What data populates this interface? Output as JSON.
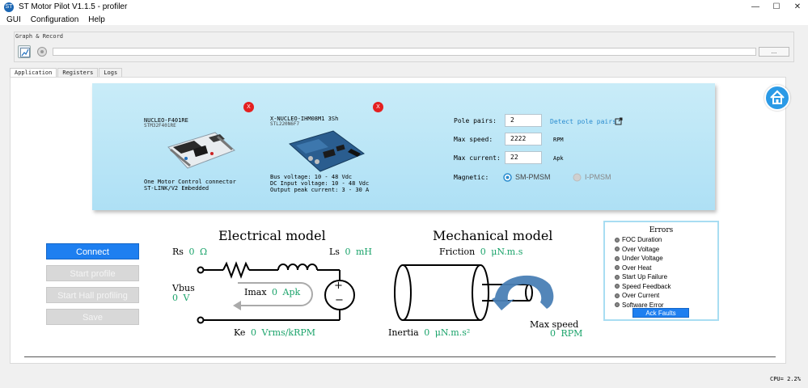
{
  "window": {
    "title": "ST Motor Pilot V1.1.5 - profiler",
    "app_icon": "ST",
    "buttons": {
      "minimize": "—",
      "maximize": "☐",
      "close": "✕"
    }
  },
  "menu": [
    "GUI",
    "Configuration",
    "Help"
  ],
  "graph_record": {
    "label": "Graph & Record",
    "browse_label": "...",
    "path_value": ""
  },
  "tabs": [
    "Application",
    "Registers",
    "Logs"
  ],
  "boards": {
    "control": {
      "name": "NUCLEO-F401RE",
      "mcu": "STM32F401RE",
      "desc1": "One Motor Control connector",
      "desc2": "ST-LINK/V2 Embedded"
    },
    "power": {
      "name": "X-NUCLEO-IHM08M1 3Sh",
      "part": "STL220N6F7",
      "bus_voltage": "Bus voltage: 10 - 48 Vdc",
      "dc_input": "DC Input voltage: 10 - 48 Vdc",
      "output_peak": "Output peak current: 3 - 30 A"
    },
    "remove_glyph": "X"
  },
  "motor": {
    "pole_pairs_label": "Pole pairs:",
    "pole_pairs_value": "2",
    "detect_label": "Detect pole pairs",
    "max_speed_label": "Max speed:",
    "max_speed_value": "2222",
    "max_speed_unit": "RPM",
    "max_current_label": "Max current:",
    "max_current_value": "22",
    "max_current_unit": "Apk",
    "magnetic_label": "Magnetic:",
    "magnetic_opt1": "SM-PMSM",
    "magnetic_opt2": "I-PMSM",
    "magnetic_selected": "SM-PMSM"
  },
  "actions": {
    "connect": "Connect",
    "start_profile": "Start profile",
    "start_hall": "Start Hall profiling",
    "save": "Save"
  },
  "electrical": {
    "title": "Electrical model",
    "rs_label": "Rs",
    "rs_value": "0",
    "rs_unit": "Ω",
    "ls_label": "Ls",
    "ls_value": "0",
    "ls_unit": "mH",
    "vbus_label": "Vbus",
    "vbus_value": "0",
    "vbus_unit": "V",
    "imax_label": "Imax",
    "imax_value": "0",
    "imax_unit": "Apk",
    "ke_label": "Ke",
    "ke_value": "0",
    "ke_unit": "Vrms/kRPM",
    "plus": "+",
    "minus": "−"
  },
  "mechanical": {
    "title": "Mechanical model",
    "friction_label": "Friction",
    "friction_value": "0",
    "friction_unit": "μN.m.s",
    "inertia_label": "Inertia",
    "inertia_value": "0",
    "inertia_unit": "μN.m.s²",
    "maxspeed_label": "Max speed",
    "maxspeed_value": "0",
    "maxspeed_unit": "RPM"
  },
  "errors": {
    "title": "Errors",
    "items": [
      "FOC Duration",
      "Over Voltage",
      "Under Voltage",
      "Over Heat",
      "Start Up Failure",
      "Speed Feedback",
      "Over Current",
      "Software Error"
    ],
    "ack": "Ack Faults"
  },
  "status": {
    "cpu": "CPU= 2.2%"
  },
  "colors": {
    "accent": "#1e7ff0",
    "panel": "#bfe6f7",
    "error_x": "#e42020"
  }
}
